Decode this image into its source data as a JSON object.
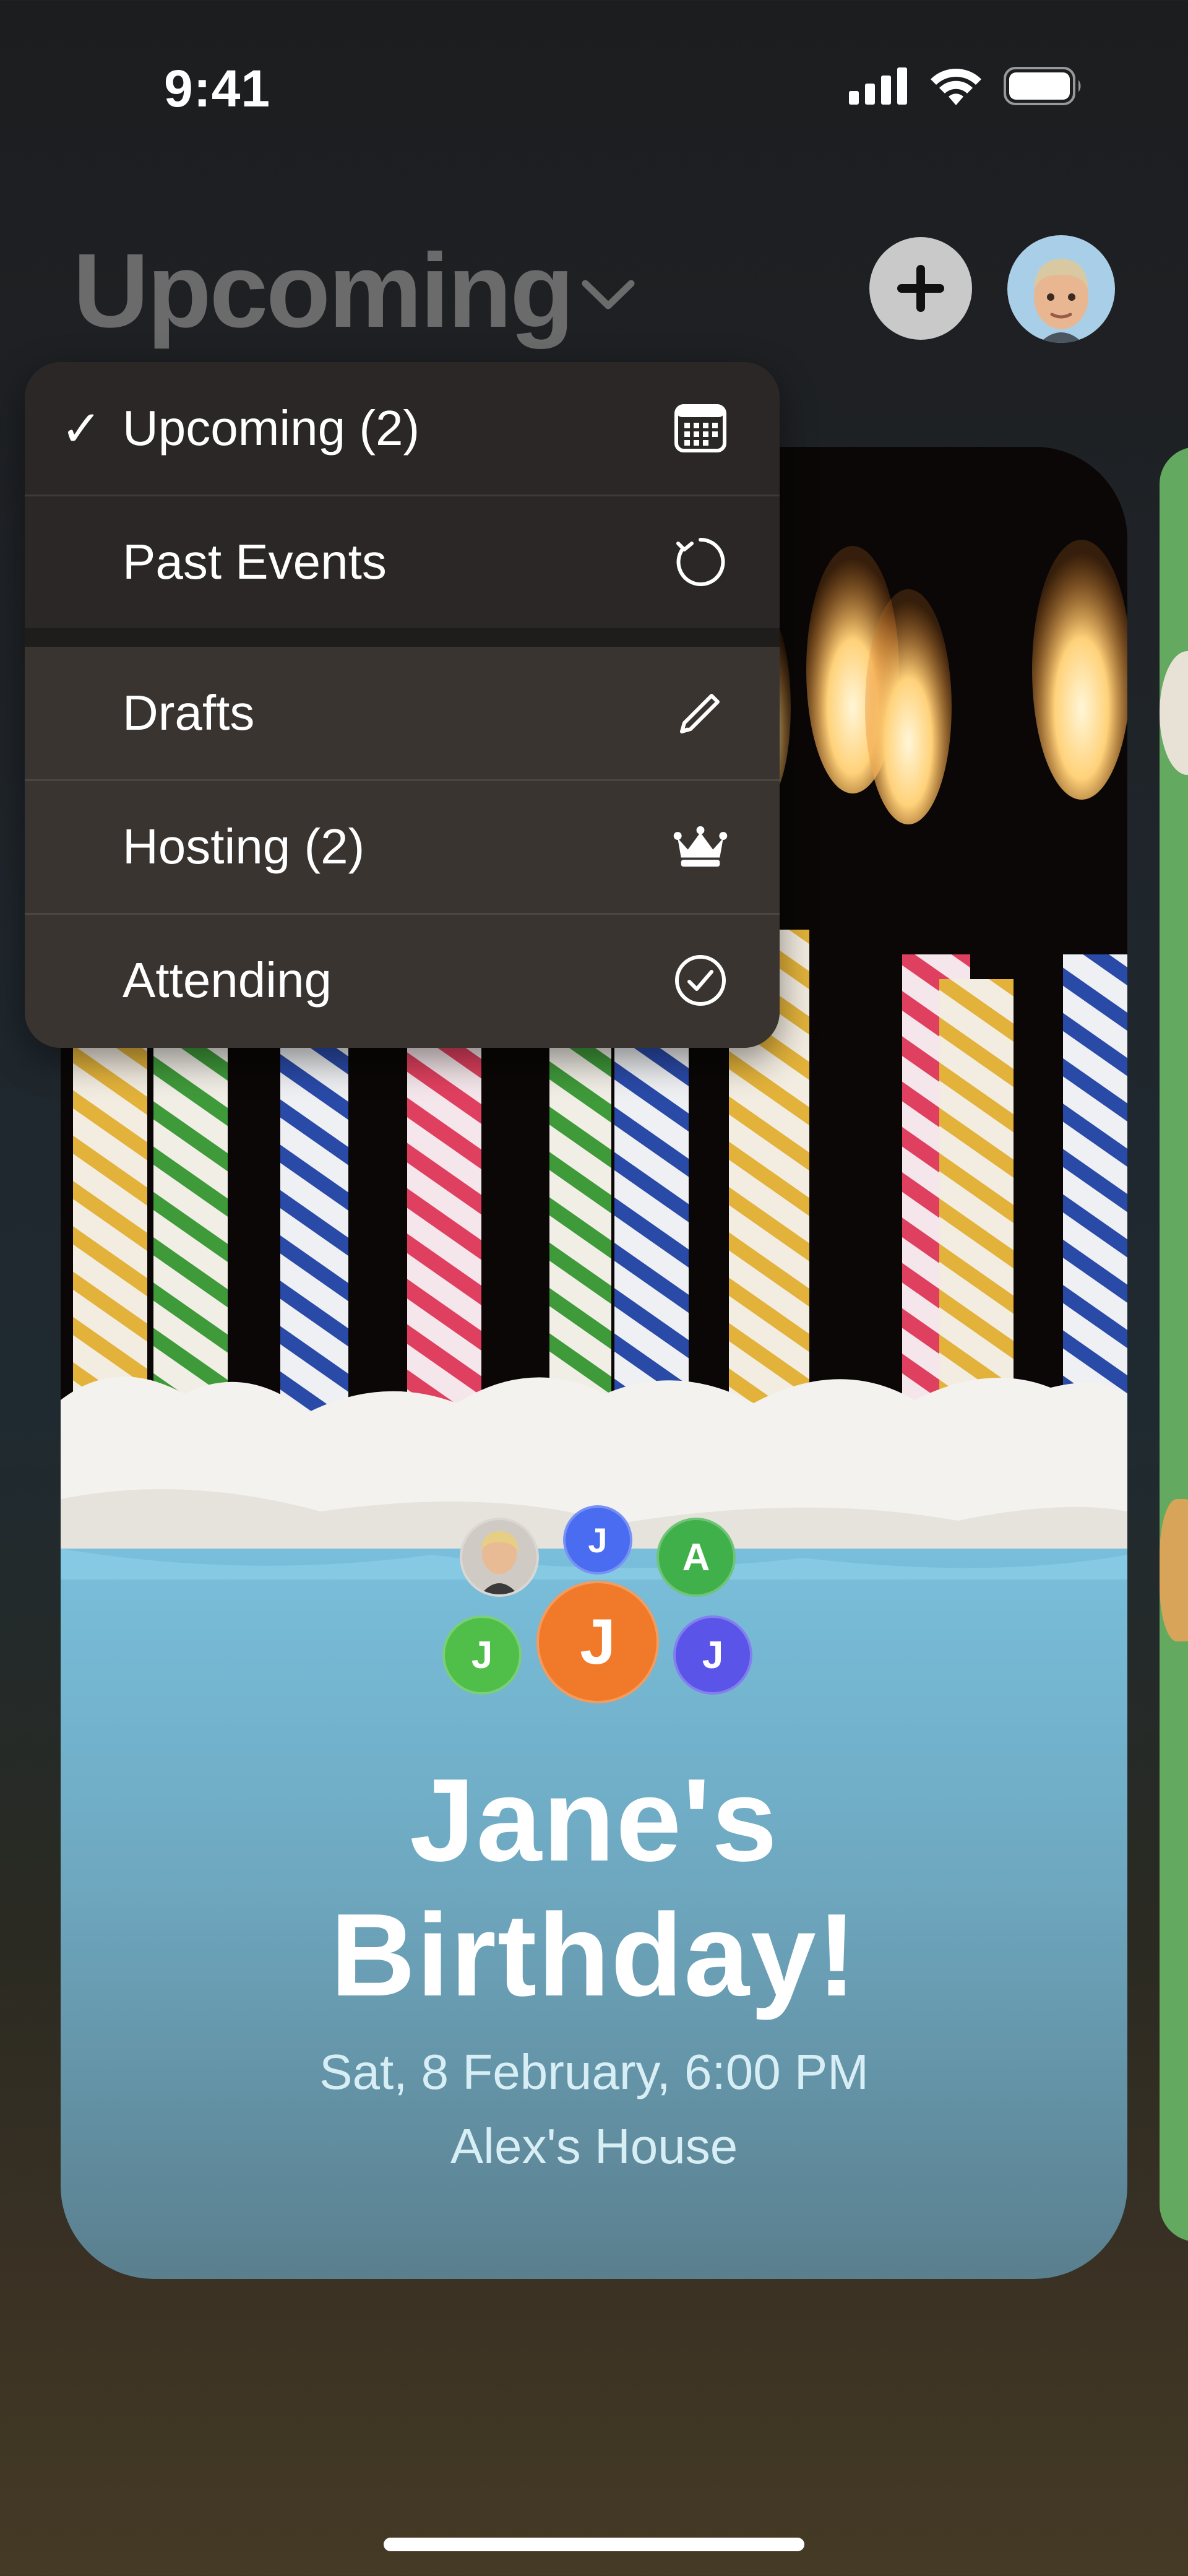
{
  "status": {
    "time": "9:41"
  },
  "header": {
    "title": "Upcoming"
  },
  "menu": {
    "items": [
      {
        "label": "Upcoming (2)",
        "icon": "calendar-icon",
        "selected": true
      },
      {
        "label": "Past Events",
        "icon": "circular-arrow-icon",
        "selected": false
      },
      {
        "label": "Drafts",
        "icon": "pencil-icon",
        "selected": false
      },
      {
        "label": "Hosting (2)",
        "icon": "crown-icon",
        "selected": false
      },
      {
        "label": "Attending",
        "icon": "checkmark-circle-icon",
        "selected": false
      }
    ]
  },
  "event": {
    "title_line1": "Jane's",
    "title_line2": "Birthday!",
    "date": "Sat, 8 February, 6:00 PM",
    "location": "Alex's House",
    "guests": [
      {
        "initial": "",
        "type": "memoji-avatar"
      },
      {
        "initial": "J",
        "color": "#4a6cf0"
      },
      {
        "initial": "A",
        "color": "#3fb04a"
      },
      {
        "initial": "J",
        "color": "#4fbf4a"
      },
      {
        "initial": "J",
        "color": "#f07a2a"
      },
      {
        "initial": "J",
        "color": "#5a55e8"
      }
    ]
  },
  "colors": {
    "card_blue": "#5f9ab0",
    "accent_orange": "#f07a2a",
    "side_card_green": "#63a960"
  }
}
